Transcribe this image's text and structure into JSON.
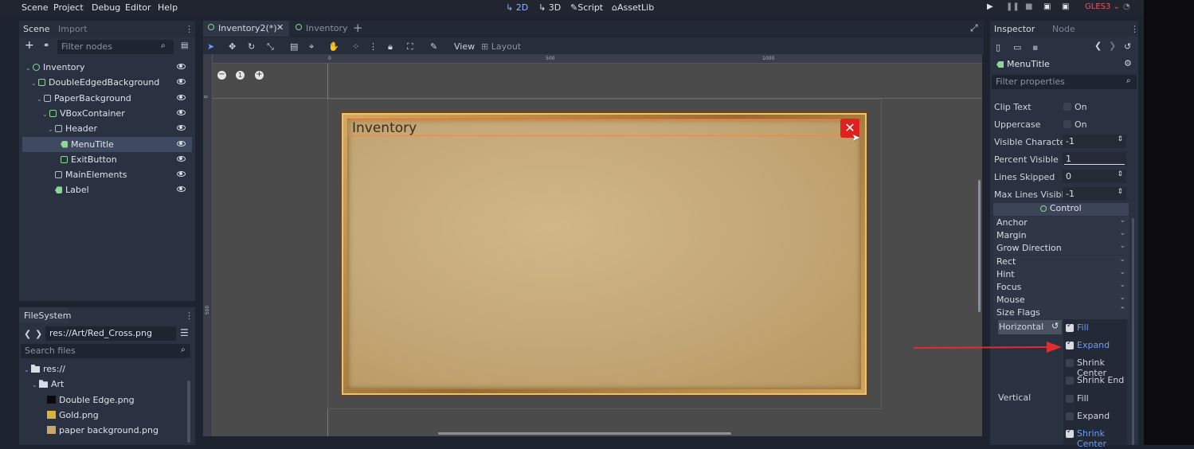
{
  "menubar": {
    "items": [
      "Scene",
      "Project",
      "Debug",
      "Editor",
      "Help"
    ],
    "workspaces": [
      "2D",
      "3D",
      "Script",
      "AssetLib"
    ],
    "renderer": "GLES3"
  },
  "scene_dock": {
    "tabs": [
      "Scene",
      "Import"
    ],
    "filter_placeholder": "Filter nodes",
    "tree": [
      {
        "name": "Inventory",
        "depth": 0,
        "icon": "control-node-icon"
      },
      {
        "name": "DoubleEdgedBackground",
        "depth": 1,
        "icon": "texture-rect-icon"
      },
      {
        "name": "PaperBackground",
        "depth": 2,
        "icon": "texture-rect-icon"
      },
      {
        "name": "VBoxContainer",
        "depth": 3,
        "icon": "vbox-container-icon"
      },
      {
        "name": "Header",
        "depth": 4,
        "icon": "hbox-container-icon"
      },
      {
        "name": "MenuTitle",
        "depth": 5,
        "icon": "label-node-icon",
        "selected": true
      },
      {
        "name": "ExitButton",
        "depth": 5,
        "icon": "texture-button-icon"
      },
      {
        "name": "MainElements",
        "depth": 4,
        "icon": "hbox-container-icon"
      },
      {
        "name": "Label",
        "depth": 4,
        "icon": "label-node-icon"
      }
    ]
  },
  "filesystem": {
    "title": "FileSystem",
    "path": "res://Art/Red_Cross.png",
    "search_placeholder": "Search files",
    "tree": [
      {
        "name": "res://",
        "depth": 0,
        "icon": "folder-icon"
      },
      {
        "name": "Art",
        "depth": 1,
        "icon": "folder-icon"
      },
      {
        "name": "Double Edge.png",
        "depth": 2,
        "icon": "image-icon",
        "color": "#0b0b0b"
      },
      {
        "name": "Gold.png",
        "depth": 2,
        "icon": "image-icon",
        "color": "#d9b23a"
      },
      {
        "name": "paper background.png",
        "depth": 2,
        "icon": "image-icon",
        "color": "#c8a86e"
      }
    ]
  },
  "editor_tabs": [
    {
      "label": "Inventory2(*)",
      "active": true
    },
    {
      "label": "Inventory",
      "active": false
    }
  ],
  "toolbar": {
    "view_label": "View",
    "layout_label": "Layout"
  },
  "ruler": {
    "marks": [
      "0",
      "500",
      "1000"
    ],
    "vmarks": [
      "0",
      "500"
    ]
  },
  "canvas": {
    "title": "Inventory",
    "close_glyph": "✕"
  },
  "inspector": {
    "tabs": [
      "Inspector",
      "Node"
    ],
    "node_name": "MenuTitle",
    "filter_placeholder": "Filter properties",
    "props": [
      {
        "name": "Clip Text",
        "type": "check",
        "value": "On"
      },
      {
        "name": "Uppercase",
        "type": "check",
        "value": "On"
      },
      {
        "name": "Visible Character",
        "type": "spin",
        "value": "-1"
      },
      {
        "name": "Percent Visible",
        "type": "slider",
        "value": "1"
      },
      {
        "name": "Lines Skipped",
        "type": "spin",
        "value": "0"
      },
      {
        "name": "Max Lines Visibl",
        "type": "spin",
        "value": "-1"
      }
    ],
    "section": "Control",
    "groups": [
      "Anchor",
      "Margin",
      "Grow Direction",
      "Rect",
      "Hint",
      "Focus",
      "Mouse",
      "Size Flags"
    ],
    "horizontal_label": "Horizontal",
    "vertical_label": "Vertical",
    "h_flags": [
      {
        "label": "Fill",
        "checked": true
      },
      {
        "label": "Expand",
        "checked": true
      },
      {
        "label": "Shrink Center",
        "checked": false
      },
      {
        "label": "Shrink End",
        "checked": false
      }
    ],
    "v_flags": [
      {
        "label": "Fill",
        "checked": false
      },
      {
        "label": "Expand",
        "checked": false
      },
      {
        "label": "Shrink Center",
        "checked": true
      }
    ]
  },
  "colors": {
    "accent": "#6a9cf6",
    "annotation_arrow": "#e02d2d",
    "selection": "#3e4a5f",
    "paper": "#c9ae7b",
    "frame": "#b8863f"
  }
}
